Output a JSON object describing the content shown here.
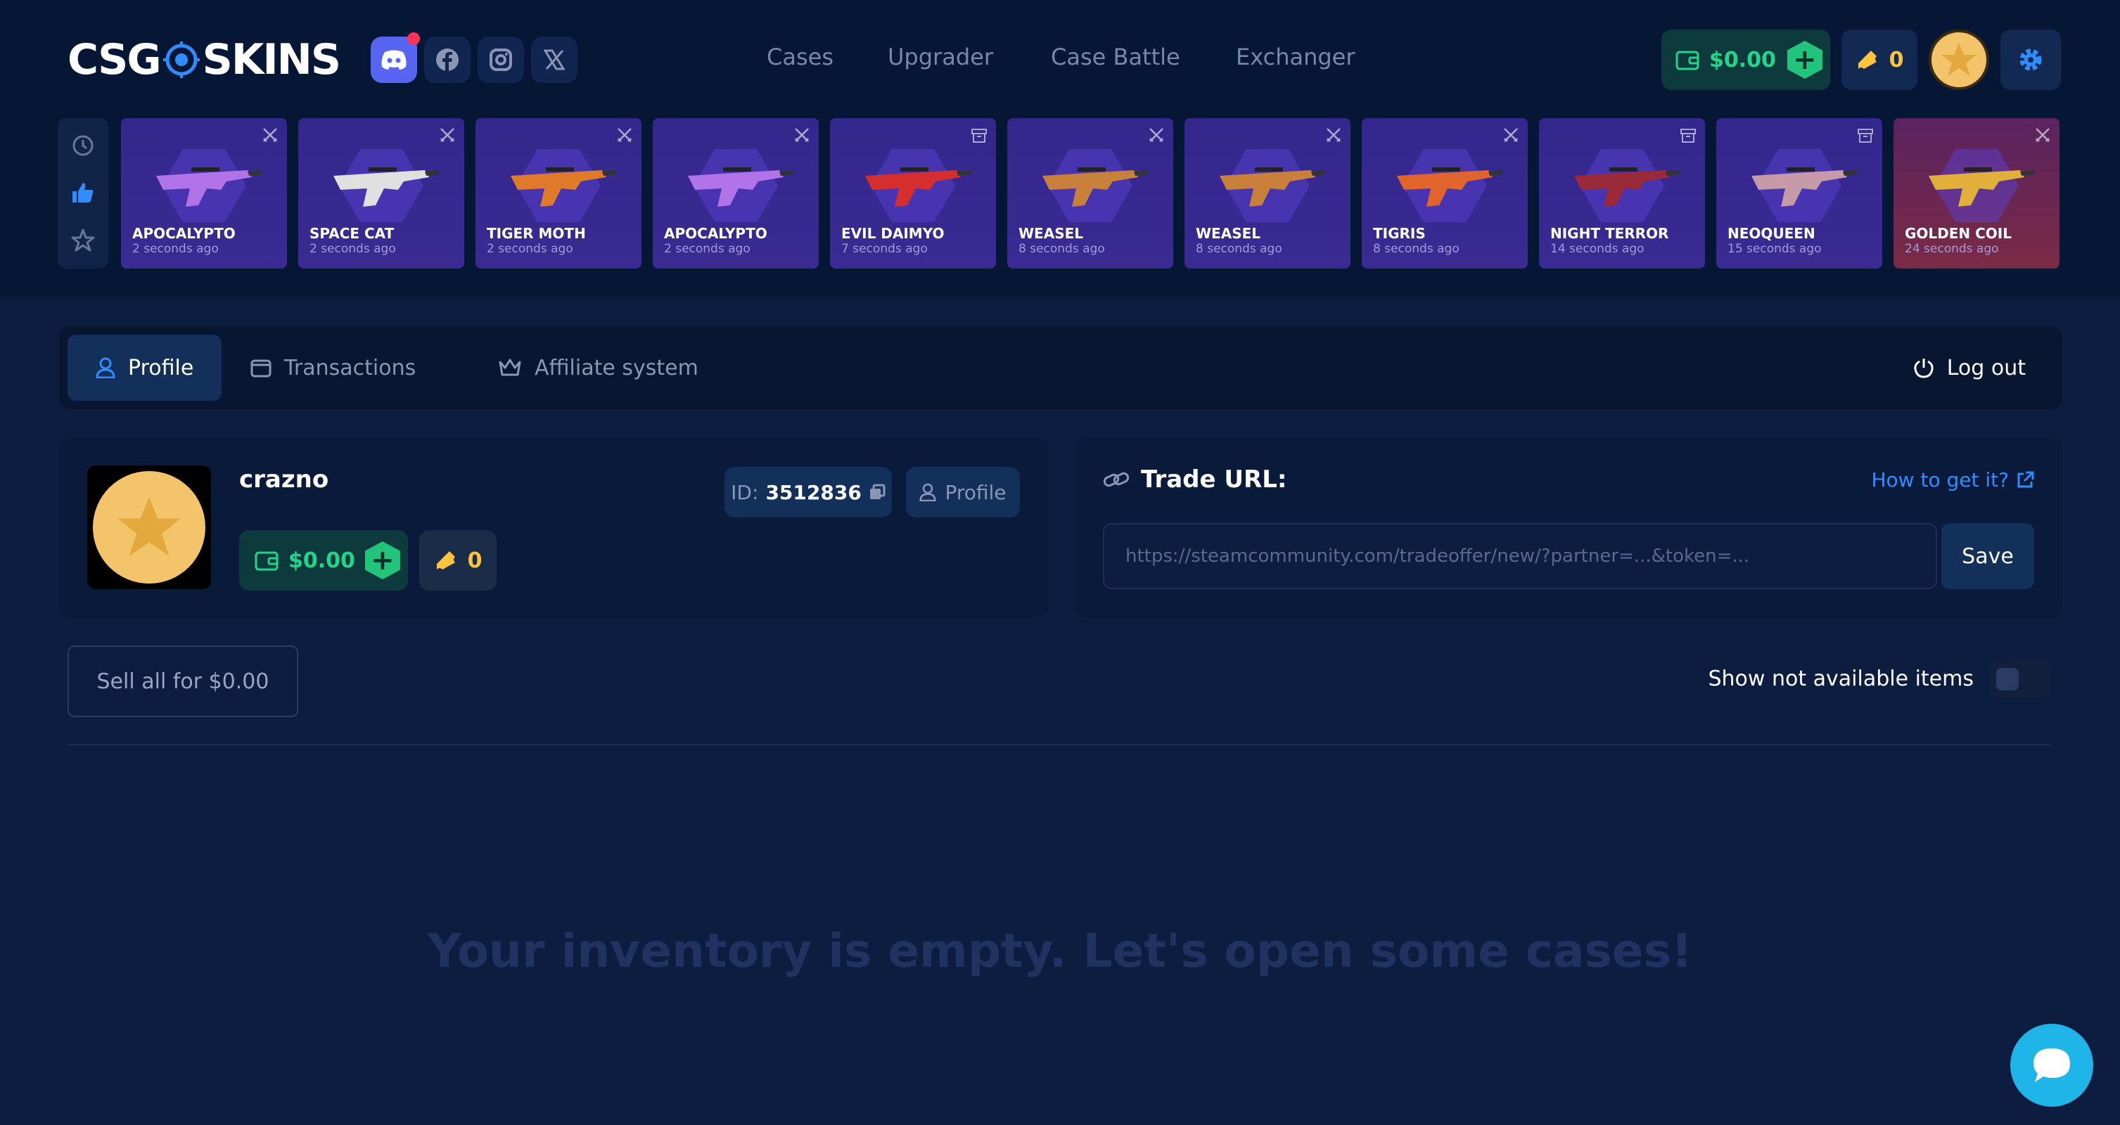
{
  "header": {
    "logo_left": "CSG",
    "logo_right": "SKINS",
    "nav": [
      "Cases",
      "Upgrader",
      "Case Battle",
      "Exchanger"
    ],
    "balance": "$0.00",
    "tickets": "0"
  },
  "live_drops": [
    {
      "name": "APOCALYPTO",
      "time": "2 seconds ago",
      "status_icon": "swords-icon",
      "gun_color": "#b074e8"
    },
    {
      "name": "SPACE CAT",
      "time": "2 seconds ago",
      "status_icon": "swords-icon",
      "gun_color": "#e0e0e0"
    },
    {
      "name": "TIGER MOTH",
      "time": "2 seconds ago",
      "status_icon": "swords-icon",
      "gun_color": "#e07a2b"
    },
    {
      "name": "APOCALYPTO",
      "time": "2 seconds ago",
      "status_icon": "swords-icon",
      "gun_color": "#b074e8"
    },
    {
      "name": "EVIL DAIMYO",
      "time": "7 seconds ago",
      "status_icon": "box-icon",
      "gun_color": "#d42e2e"
    },
    {
      "name": "WEASEL",
      "time": "8 seconds ago",
      "status_icon": "swords-icon",
      "gun_color": "#c8803a"
    },
    {
      "name": "WEASEL",
      "time": "8 seconds ago",
      "status_icon": "swords-icon",
      "gun_color": "#c8803a"
    },
    {
      "name": "TIGRIS",
      "time": "8 seconds ago",
      "status_icon": "swords-icon",
      "gun_color": "#e0642b"
    },
    {
      "name": "NIGHT TERROR",
      "time": "14 seconds ago",
      "status_icon": "box-icon",
      "gun_color": "#9a2a3a"
    },
    {
      "name": "NEOQUEEN",
      "time": "15 seconds ago",
      "status_icon": "box-icon",
      "gun_color": "#c79aa8"
    },
    {
      "name": "GOLDEN COIL",
      "time": "24 seconds ago",
      "status_icon": "swords-icon",
      "gun_color": "#e0b03a"
    }
  ],
  "tabs": {
    "profile": "Profile",
    "transactions": "Transactions",
    "affiliate": "Affiliate system",
    "logout": "Log out"
  },
  "profile": {
    "username": "crazno",
    "id_label": "ID:",
    "id_value": "3512836",
    "profile_button": "Profile",
    "balance": "$0.00",
    "tickets": "0"
  },
  "trade": {
    "title": "Trade URL:",
    "how_to": "How to get it?",
    "placeholder": "https://steamcommunity.com/tradeoffer/new/?partner=...&token=...",
    "save": "Save"
  },
  "inventory": {
    "sell_all": "Sell all for $0.00",
    "show_not_available": "Show not available items",
    "empty_message": "Your inventory is empty. Let's open some cases!"
  },
  "colors": {
    "accent_green": "#23d58b",
    "accent_blue": "#2f8dff",
    "ticket_yellow": "#ffc43d",
    "background": "#0c1d40"
  }
}
